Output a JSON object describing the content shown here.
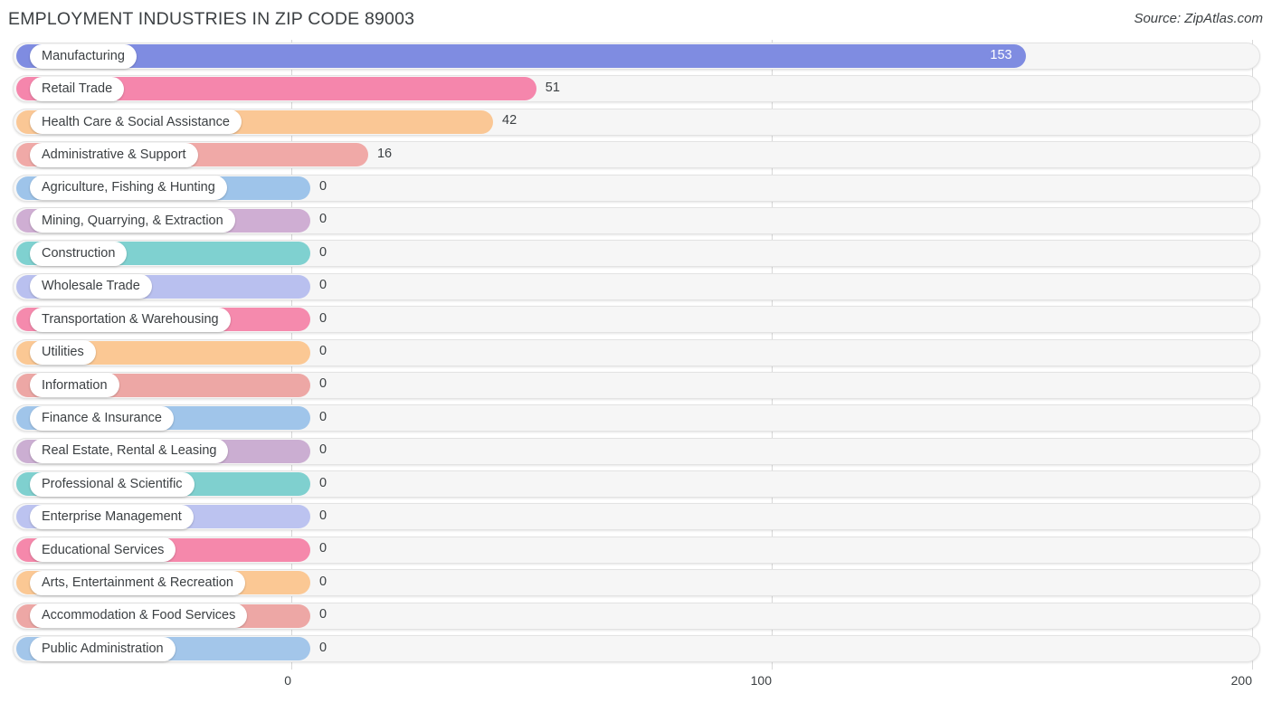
{
  "header": {
    "title": "EMPLOYMENT INDUSTRIES IN ZIP CODE 89003",
    "source": "Source: ZipAtlas.com"
  },
  "chart_data": {
    "type": "bar",
    "orientation": "horizontal",
    "title": "EMPLOYMENT INDUSTRIES IN ZIP CODE 89003",
    "subtitle": "Source: ZipAtlas.com",
    "xlabel": "",
    "ylabel": "",
    "xlim": [
      0,
      200
    ],
    "xticks": [
      0,
      100,
      200
    ],
    "xtick_labels": [
      "0",
      "100",
      "200"
    ],
    "grid": true,
    "legend": "none",
    "categories": [
      "Manufacturing",
      "Retail Trade",
      "Health Care & Social Assistance",
      "Administrative & Support",
      "Agriculture, Fishing & Hunting",
      "Mining, Quarrying, & Extraction",
      "Construction",
      "Wholesale Trade",
      "Transportation & Warehousing",
      "Utilities",
      "Information",
      "Finance & Insurance",
      "Real Estate, Rental & Leasing",
      "Professional & Scientific",
      "Enterprise Management",
      "Educational Services",
      "Arts, Entertainment & Recreation",
      "Accommodation & Food Services",
      "Public Administration"
    ],
    "values": [
      153,
      51,
      42,
      16,
      0,
      0,
      0,
      0,
      0,
      0,
      0,
      0,
      0,
      0,
      0,
      0,
      0,
      0,
      0
    ],
    "value_labels": [
      "153",
      "51",
      "42",
      "16",
      "0",
      "0",
      "0",
      "0",
      "0",
      "0",
      "0",
      "0",
      "0",
      "0",
      "0",
      "0",
      "0",
      "0",
      "0"
    ],
    "colors": [
      "#7f8ce1",
      "#f586ac",
      "#fac795",
      "#f0a9a7",
      "#9ec4ea",
      "#cfaed3",
      "#7fd1d0",
      "#b9c0ef",
      "#f58aad",
      "#fbc894",
      "#eda7a5",
      "#a0c5ea",
      "#cbaed2",
      "#7fd0cf",
      "#bcc3f0",
      "#f588ab",
      "#fbc894",
      "#eda7a5",
      "#a3c6ea"
    ]
  },
  "axis": {
    "ticks": [
      {
        "label": "0",
        "value": 0
      },
      {
        "label": "100",
        "value": 100
      },
      {
        "label": "200",
        "value": 200
      }
    ]
  }
}
